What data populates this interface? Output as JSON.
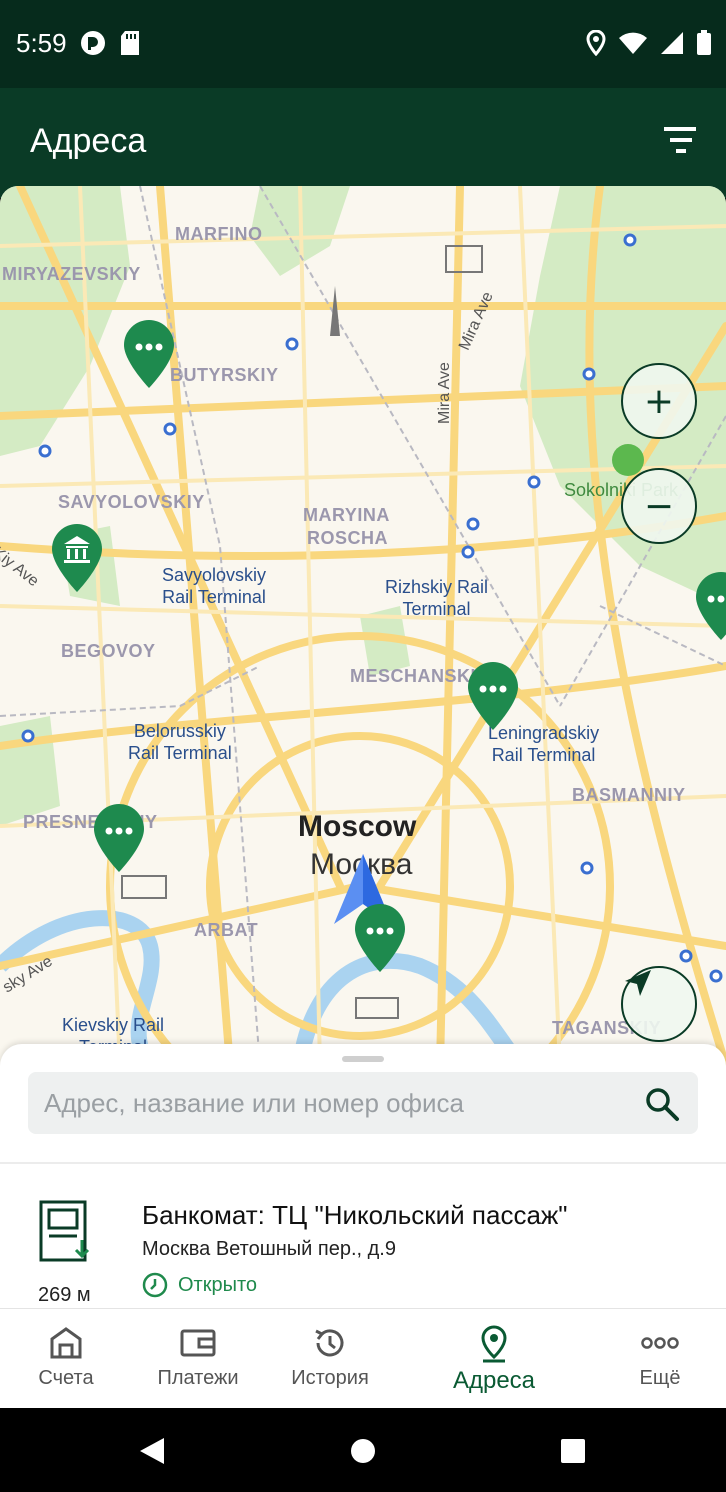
{
  "status_bar": {
    "time": "5:59"
  },
  "app_bar": {
    "title": "Адреса"
  },
  "map": {
    "districts": [
      "MARFINO",
      "MIRYAZEVSKIY",
      "BUTYRSKIY",
      "SAVYOLOVSKIY",
      "MARYINA",
      "ROSCHA",
      "BEGOVOY",
      "MESCHANSKIY",
      "BASMANNIY",
      "PRESNENSKIY",
      "ARBAT",
      "TAGANSKIY"
    ],
    "stations": {
      "savyolovsky": "Savyolovskiy\nRail Terminal",
      "rizhsky": "Rizhskiy Rail\nTerminal",
      "belorussky": "Belorusskiy\nRail Terminal",
      "leningradsky": "Leningradskiy\nRail Terminal",
      "kievsky": "Kievskiy Rail\nTerminal"
    },
    "city_en": "Moscow",
    "city_ru": "Москва",
    "streets": [
      "Mira Ave",
      "Mira Ave",
      "Kiy Ave",
      "sky Ave"
    ],
    "park": "Sokolniki Park"
  },
  "controls": {
    "zoom_in": "+",
    "zoom_out": "−"
  },
  "search": {
    "placeholder": "Адрес, название или номер офиса"
  },
  "result": {
    "title": "Банкомат: ТЦ \"Никольский пассаж\"",
    "address": "Москва Ветошный пер., д.9",
    "status": "Открыто",
    "distance": "269 м"
  },
  "nav": {
    "items": [
      {
        "label": "Счета",
        "icon": "bank-icon"
      },
      {
        "label": "Платежи",
        "icon": "wallet-icon"
      },
      {
        "label": "История",
        "icon": "history-icon"
      },
      {
        "label": "Адреса",
        "icon": "location-pin-icon"
      },
      {
        "label": "Ещё",
        "icon": "more-dots-icon"
      }
    ],
    "active_index": 3
  },
  "colors": {
    "brand": "#0a3b26",
    "pin": "#1e8a4e",
    "accent": "#1f8a4c"
  }
}
